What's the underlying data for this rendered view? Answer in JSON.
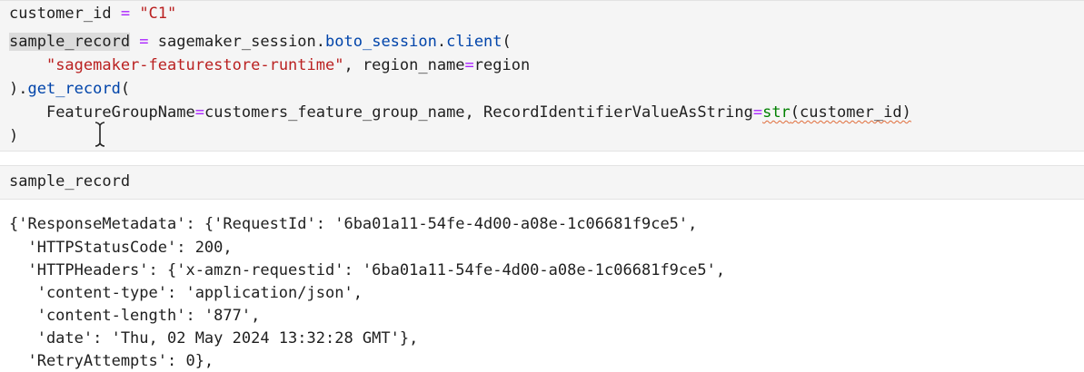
{
  "cell1": {
    "l1": {
      "var": "customer_id",
      "eq": " = ",
      "str": "\"C1\""
    },
    "l2": {
      "var": "sample_record",
      "eq": " = ",
      "obj": "sagemaker_session",
      "dot1": ".",
      "attr1": "boto_session",
      "dot2": ".",
      "attr2": "client",
      "paren": "("
    },
    "l3": {
      "indent": "    ",
      "str": "\"sagemaker-featurestore-runtime\"",
      "rest": ", region_name",
      "eq": "=",
      "val": "region"
    },
    "l4": {
      "close": ").",
      "attr": "get_record",
      "paren": "("
    },
    "l5": {
      "indent": "    ",
      "kw1": "FeatureGroupName",
      "eq1": "=",
      "val1": "customers_feature_group_name, ",
      "kw2": "RecordIdentifierValueAsString",
      "eq2": "=",
      "fn": "str",
      "arg": "(customer_id)"
    },
    "l6": {
      "text": ")"
    }
  },
  "cell2": {
    "text": "sample_record"
  },
  "output": {
    "lines": [
      "{'ResponseMetadata': {'RequestId': '6ba01a11-54fe-4d00-a08e-1c06681f9ce5',",
      "  'HTTPStatusCode': 200,",
      "  'HTTPHeaders': {'x-amzn-requestid': '6ba01a11-54fe-4d00-a08e-1c06681f9ce5',",
      "   'content-type': 'application/json',",
      "   'content-length': '877',",
      "   'date': 'Thu, 02 May 2024 13:32:28 GMT'},",
      "  'RetryAttempts': 0},"
    ]
  },
  "colors": {
    "string": "#ba2121",
    "operator": "#aa22ff",
    "attribute": "#0044aa",
    "builtin": "#008000",
    "cell_bg": "#f5f5f5"
  },
  "icons": {
    "cursor": "text-cursor-icon"
  }
}
